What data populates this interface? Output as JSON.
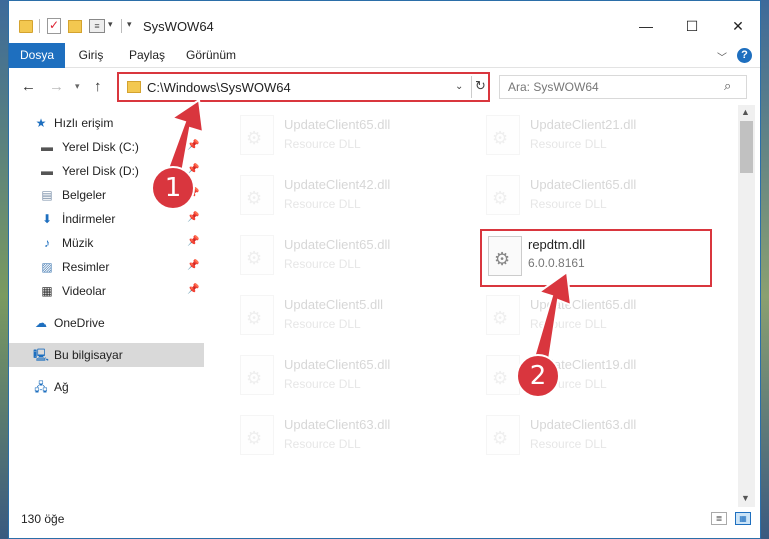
{
  "window": {
    "title": "SysWOW64",
    "minimize": "—",
    "maximize": "☐",
    "close": "✕"
  },
  "ribbon": {
    "tabs": [
      "Dosya",
      "Giriş",
      "Paylaş",
      "Görünüm"
    ],
    "help": "?"
  },
  "address": {
    "path": "C:\\Windows\\SysWOW64",
    "search_placeholder": "Ara: SysWOW64"
  },
  "navigation": {
    "quick_access": "Hızlı erişim",
    "items": [
      {
        "label": "Yerel Disk (C:)",
        "icon": "drive-icon"
      },
      {
        "label": "Yerel Disk (D:)",
        "icon": "drive-icon"
      },
      {
        "label": "Belgeler",
        "icon": "documents-icon"
      },
      {
        "label": "İndirmeler",
        "icon": "downloads-icon"
      },
      {
        "label": "Müzik",
        "icon": "music-icon"
      },
      {
        "label": "Resimler",
        "icon": "pictures-icon"
      },
      {
        "label": "Videolar",
        "icon": "videos-icon"
      }
    ],
    "onedrive": "OneDrive",
    "this_pc": "Bu bilgisayar",
    "network": "Ağ"
  },
  "files": [
    {
      "name": "UpdateClient65.dll",
      "type": "Resource DLL"
    },
    {
      "name": "UpdateClient21.dll",
      "type": "Resource DLL"
    },
    {
      "name": "UpdateClient42.dll",
      "type": "Resource DLL"
    },
    {
      "name": "UpdateClient65.dll",
      "type": "Resource DLL"
    },
    {
      "name": "UpdateClient65.dll",
      "type": "Resource DLL"
    },
    {
      "name": "repdtm.dll",
      "type": "6.0.0.8161"
    },
    {
      "name": "UpdateClient5.dll",
      "type": "Resource DLL"
    },
    {
      "name": "UpdateClient65.dll",
      "type": "Resource DLL"
    },
    {
      "name": "UpdateClient65.dll",
      "type": "Resource DLL"
    },
    {
      "name": "UpdateClient19.dll",
      "type": "Resource DLL"
    },
    {
      "name": "UpdateClient63.dll",
      "type": "Resource DLL"
    },
    {
      "name": "UpdateClient63.dll",
      "type": "Resource DLL"
    }
  ],
  "status": {
    "item_count": "130 öğe"
  },
  "annotations": {
    "step1": "1",
    "step2": "2",
    "color": "#d9363e"
  }
}
